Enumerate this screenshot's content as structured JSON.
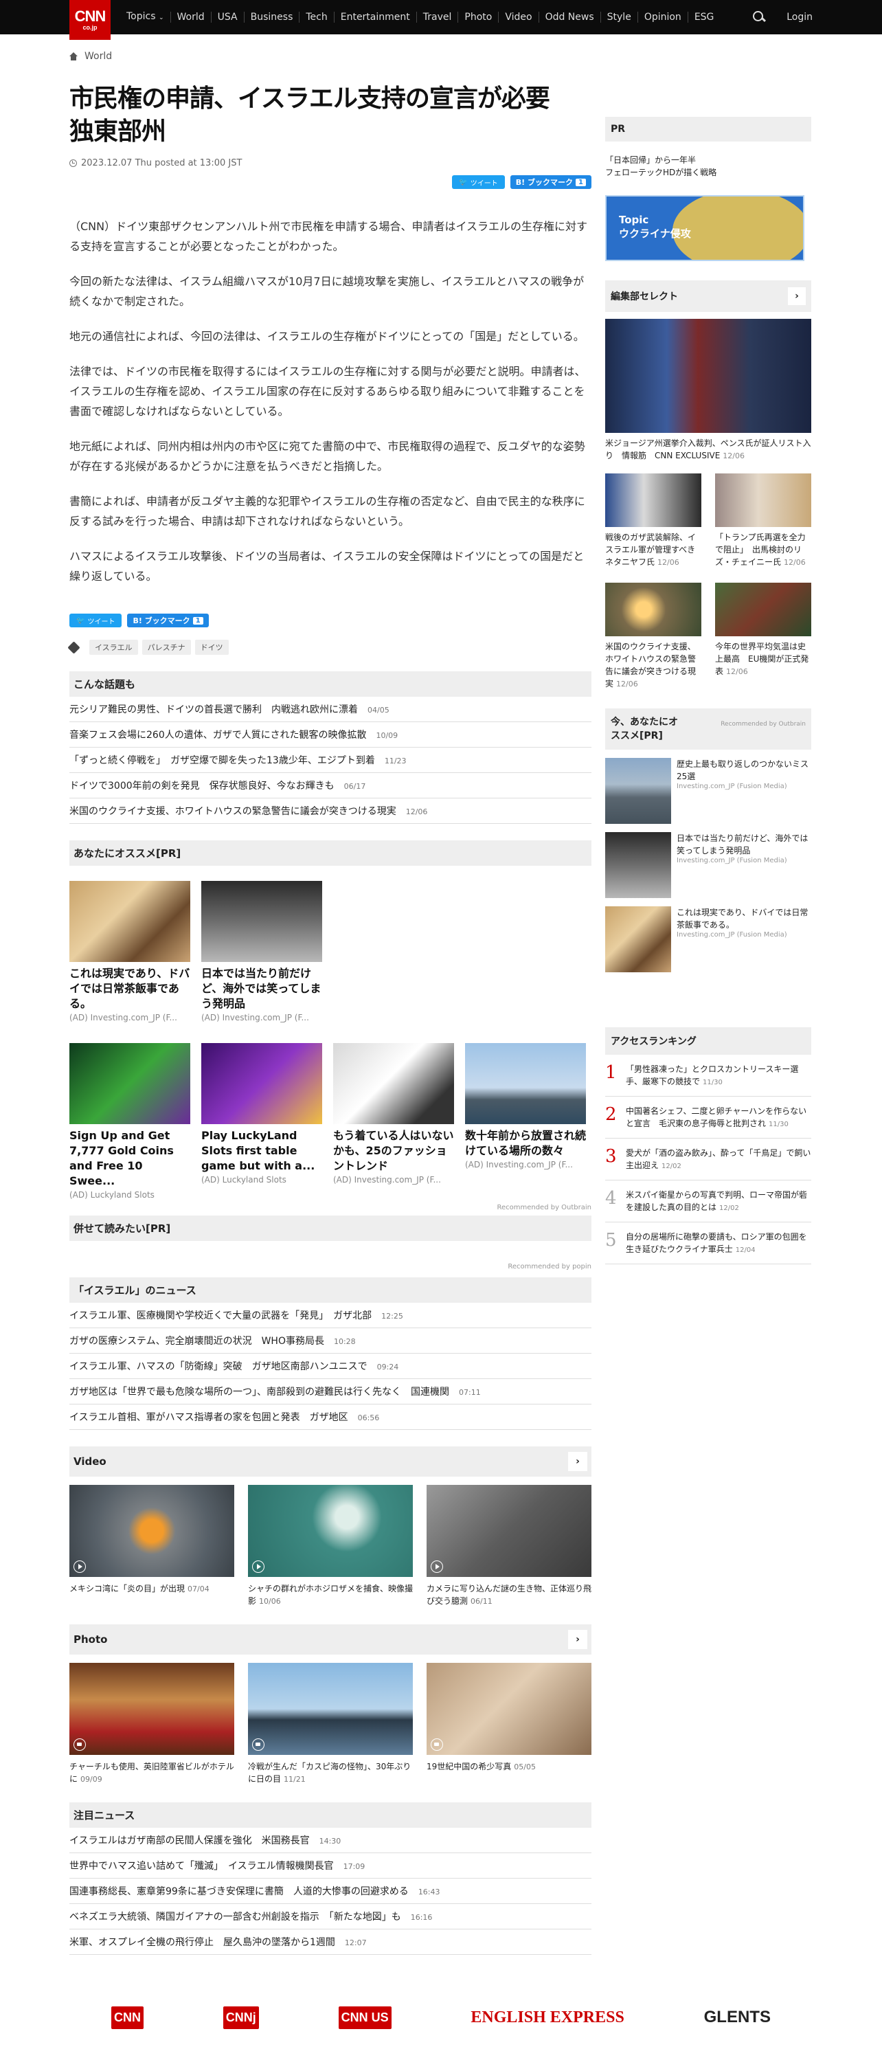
{
  "nav": {
    "logo": "CNN",
    "logo_sub": "co.jp",
    "items": [
      "Topics",
      "World",
      "USA",
      "Business",
      "Tech",
      "Entertainment",
      "Travel",
      "Photo",
      "Video",
      "Odd News",
      "Style",
      "Opinion",
      "ESG"
    ],
    "login": "Login"
  },
  "breadcrumb": {
    "section": "World"
  },
  "article": {
    "title": "市民権の申請、イスラエル支持の宣言が必要　独東部州",
    "date": "2023.12.07 Thu posted at 13:00 JST",
    "tweet_label": "ツイート",
    "bookmark_label": "B! ブックマーク",
    "bookmark_count": "1",
    "paragraphs": [
      "（CNN）ドイツ東部ザクセンアンハルト州で市民権を申請する場合、申請者はイスラエルの生存権に対する支持を宣言することが必要となったことがわかった。",
      "今回の新たな法律は、イスラム組織ハマスが10月7日に越境攻撃を実施し、イスラエルとハマスの戦争が続くなかで制定された。",
      "地元の通信社によれば、今回の法律は、イスラエルの生存権がドイツにとっての「国是」だとしている。",
      "法律では、ドイツの市民権を取得するにはイスラエルの生存権に対する関与が必要だと説明。申請者は、イスラエルの生存権を認め、イスラエル国家の存在に反対するあらゆる取り組みについて非難することを書面で確認しなければならないとしている。",
      "地元紙によれば、同州内相は州内の市や区に宛てた書簡の中で、市民権取得の過程で、反ユダヤ的な姿勢が存在する兆候があるかどうかに注意を払うべきだと指摘した。",
      "書簡によれば、申請者が反ユダヤ主義的な犯罪やイスラエルの生存権の否定など、自由で民主的な秩序に反する試みを行った場合、申請は却下されなければならないという。",
      "ハマスによるイスラエル攻撃後、ドイツの当局者は、イスラエルの安全保障はドイツにとっての国是だと繰り返している。"
    ],
    "tags": [
      "イスラエル",
      "パレスチナ",
      "ドイツ"
    ]
  },
  "related": {
    "heading": "こんな話題も",
    "items": [
      {
        "title": "元シリア難民の男性、ドイツの首長選で勝利　内戦逃れ欧州に漂着",
        "date": "04/05"
      },
      {
        "title": "音楽フェス会場に260人の遺体、ガザで人質にされた観客の映像拡散",
        "date": "10/09"
      },
      {
        "title": "「ずっと続く停戦を」　ガザ空爆で脚を失った13歳少年、エジプト到着",
        "date": "11/23"
      },
      {
        "title": "ドイツで3000年前の剣を発見　保存状態良好、今なお輝きも",
        "date": "06/17"
      },
      {
        "title": "米国のウクライナ支援、ホワイトハウスの緊急警告に議会が突きつける現実",
        "date": "12/06"
      }
    ]
  },
  "recommend": {
    "heading": "あなたにオススメ[PR]",
    "top": [
      {
        "title": "これは現実であり、ドバイでは日常茶飯事である。",
        "source": "(AD) Investing.com_JP (F..."
      },
      {
        "title": "日本では当たり前だけど、海外では笑ってしまう発明品",
        "source": "(AD) Investing.com_JP (F..."
      }
    ],
    "bottom": [
      {
        "title": "Sign Up and Get 7,777 Gold Coins and Free 10 Swee...",
        "source": "(AD) Luckyland Slots"
      },
      {
        "title": "Play LuckyLand Slots first table game but with a...",
        "source": "(AD) Luckyland Slots"
      },
      {
        "title": "もう着ている人はいないかも、25のファッショントレンド",
        "source": "(AD) Investing.com_JP (F..."
      },
      {
        "title": "数十年前から放置され続けている場所の数々",
        "source": "(AD) Investing.com_JP (F..."
      }
    ],
    "note": "Recommended by Outbrain"
  },
  "readalso": {
    "heading": "併せて読みたい[PR]",
    "note": "Recommended by popin"
  },
  "israel_news": {
    "heading": "「イスラエル」のニュース",
    "items": [
      {
        "title": "イスラエル軍、医療機関や学校近くで大量の武器を「発見」　ガザ北部",
        "date": "12:25"
      },
      {
        "title": "ガザの医療システム、完全崩壊間近の状況　WHO事務局長",
        "date": "10:28"
      },
      {
        "title": "イスラエル軍、ハマスの「防衛線」突破　ガザ地区南部ハンユニスで",
        "date": "09:24"
      },
      {
        "title": "ガザ地区は「世界で最も危険な場所の一つ」、南部殺到の避難民は行く先なく　国連機関",
        "date": "07:11"
      },
      {
        "title": "イスラエル首相、軍がハマス指導者の家を包囲と発表　ガザ地区",
        "date": "06:56"
      }
    ]
  },
  "video": {
    "heading": "Video",
    "items": [
      {
        "title": "メキシコ湾に「炎の目」が出現",
        "date": "07/04"
      },
      {
        "title": "シャチの群れがホホジロザメを捕食、映像撮影",
        "date": "10/06"
      },
      {
        "title": "カメラに写り込んだ謎の生き物、正体巡り飛び交う臆測",
        "date": "06/11"
      }
    ]
  },
  "photo": {
    "heading": "Photo",
    "items": [
      {
        "title": "チャーチルも使用、英旧陸軍省ビルがホテルに",
        "date": "09/09"
      },
      {
        "title": "冷戦が生んだ「カスピ海の怪物」、30年ぶりに日の目",
        "date": "11/21"
      },
      {
        "title": "19世紀中国の希少写真",
        "date": "05/05"
      }
    ]
  },
  "featured": {
    "heading": "注目ニュース",
    "items": [
      {
        "title": "イスラエルはガザ南部の民間人保護を強化　米国務長官",
        "date": "14:30"
      },
      {
        "title": "世界中でハマス追い詰めて「殲滅」　イスラエル情報機関長官",
        "date": "17:09"
      },
      {
        "title": "国連事務総長、憲章第99条に基づき安保理に書簡　人道的大惨事の回避求める",
        "date": "16:43"
      },
      {
        "title": "ベネズエラ大統領、隣国ガイアナの一部含む州創設を指示　「新たな地図」も",
        "date": "16:16"
      },
      {
        "title": "米軍、オスプレイ全機の飛行停止　屋久島沖の墜落から1週間",
        "date": "12:07"
      }
    ]
  },
  "sidebar": {
    "pr_heading": "PR",
    "pr_text": "「日本回帰」から一年半\nフェローテックHDが描く戦略",
    "banner_line1": "Topic",
    "banner_line2": "ウクライナ侵攻",
    "select_heading": "編集部セレクト",
    "select_big": {
      "title": "米ジョージア州選挙介入裁判、ペンス氏が証人リスト入り　情報筋　CNN EXCLUSIVE",
      "date": "12/06"
    },
    "select_small": [
      {
        "title": "戦後のガザ武装解除、イスラエル軍が管理すべき　ネタニヤフ氏",
        "date": "12/06"
      },
      {
        "title": "「トランプ氏再選を全力で阻止」　出馬検討のリズ・チェイニー氏",
        "date": "12/06"
      },
      {
        "title": "米国のウクライナ支援、ホワイトハウスの緊急警告に議会が突きつける現実",
        "date": "12/06"
      },
      {
        "title": "今年の世界平均気温は史上最高　EU機関が正式発表",
        "date": "12/06"
      }
    ],
    "outbrain_heading": "今、あなたにオススメ[PR]",
    "outbrain_note": "Recommended by Outbrain",
    "outbrain_items": [
      {
        "title": "歴史上最も取り返しのつかないミス25選",
        "source": "Investing.com_JP (Fusion Media)"
      },
      {
        "title": "日本では当たり前だけど、海外では笑ってしまう発明品",
        "source": "Investing.com_JP (Fusion Media)"
      },
      {
        "title": "これは現実であり、ドバイでは日常茶飯事である。",
        "source": "Investing.com_JP (Fusion Media)"
      }
    ],
    "ranking_heading": "アクセスランキング",
    "ranking": [
      {
        "n": "1",
        "title": "「男性器凍った」とクロスカントリースキー選手、厳寒下の競技で",
        "date": "11/30"
      },
      {
        "n": "2",
        "title": "中国著名シェフ、二度と卵チャーハンを作らないと宣言　毛沢東の息子侮辱と批判され",
        "date": "11/30"
      },
      {
        "n": "3",
        "title": "愛犬が「酒の盗み飲み」、酔って「千鳥足」で飼い主出迎え",
        "date": "12/02"
      },
      {
        "n": "4",
        "title": "米スパイ衛星からの写真で判明、ローマ帝国が砦を建設した真の目的とは",
        "date": "12/02"
      },
      {
        "n": "5",
        "title": "自分の居場所に砲撃の要請も、ロシア軍の包囲を生き延びたウクライナ軍兵士",
        "date": "12/04"
      }
    ]
  },
  "footer": {
    "logos": [
      "CNN",
      "CNNj",
      "CNN US",
      "ENGLISH EXPRESS",
      "GLENTS"
    ]
  }
}
